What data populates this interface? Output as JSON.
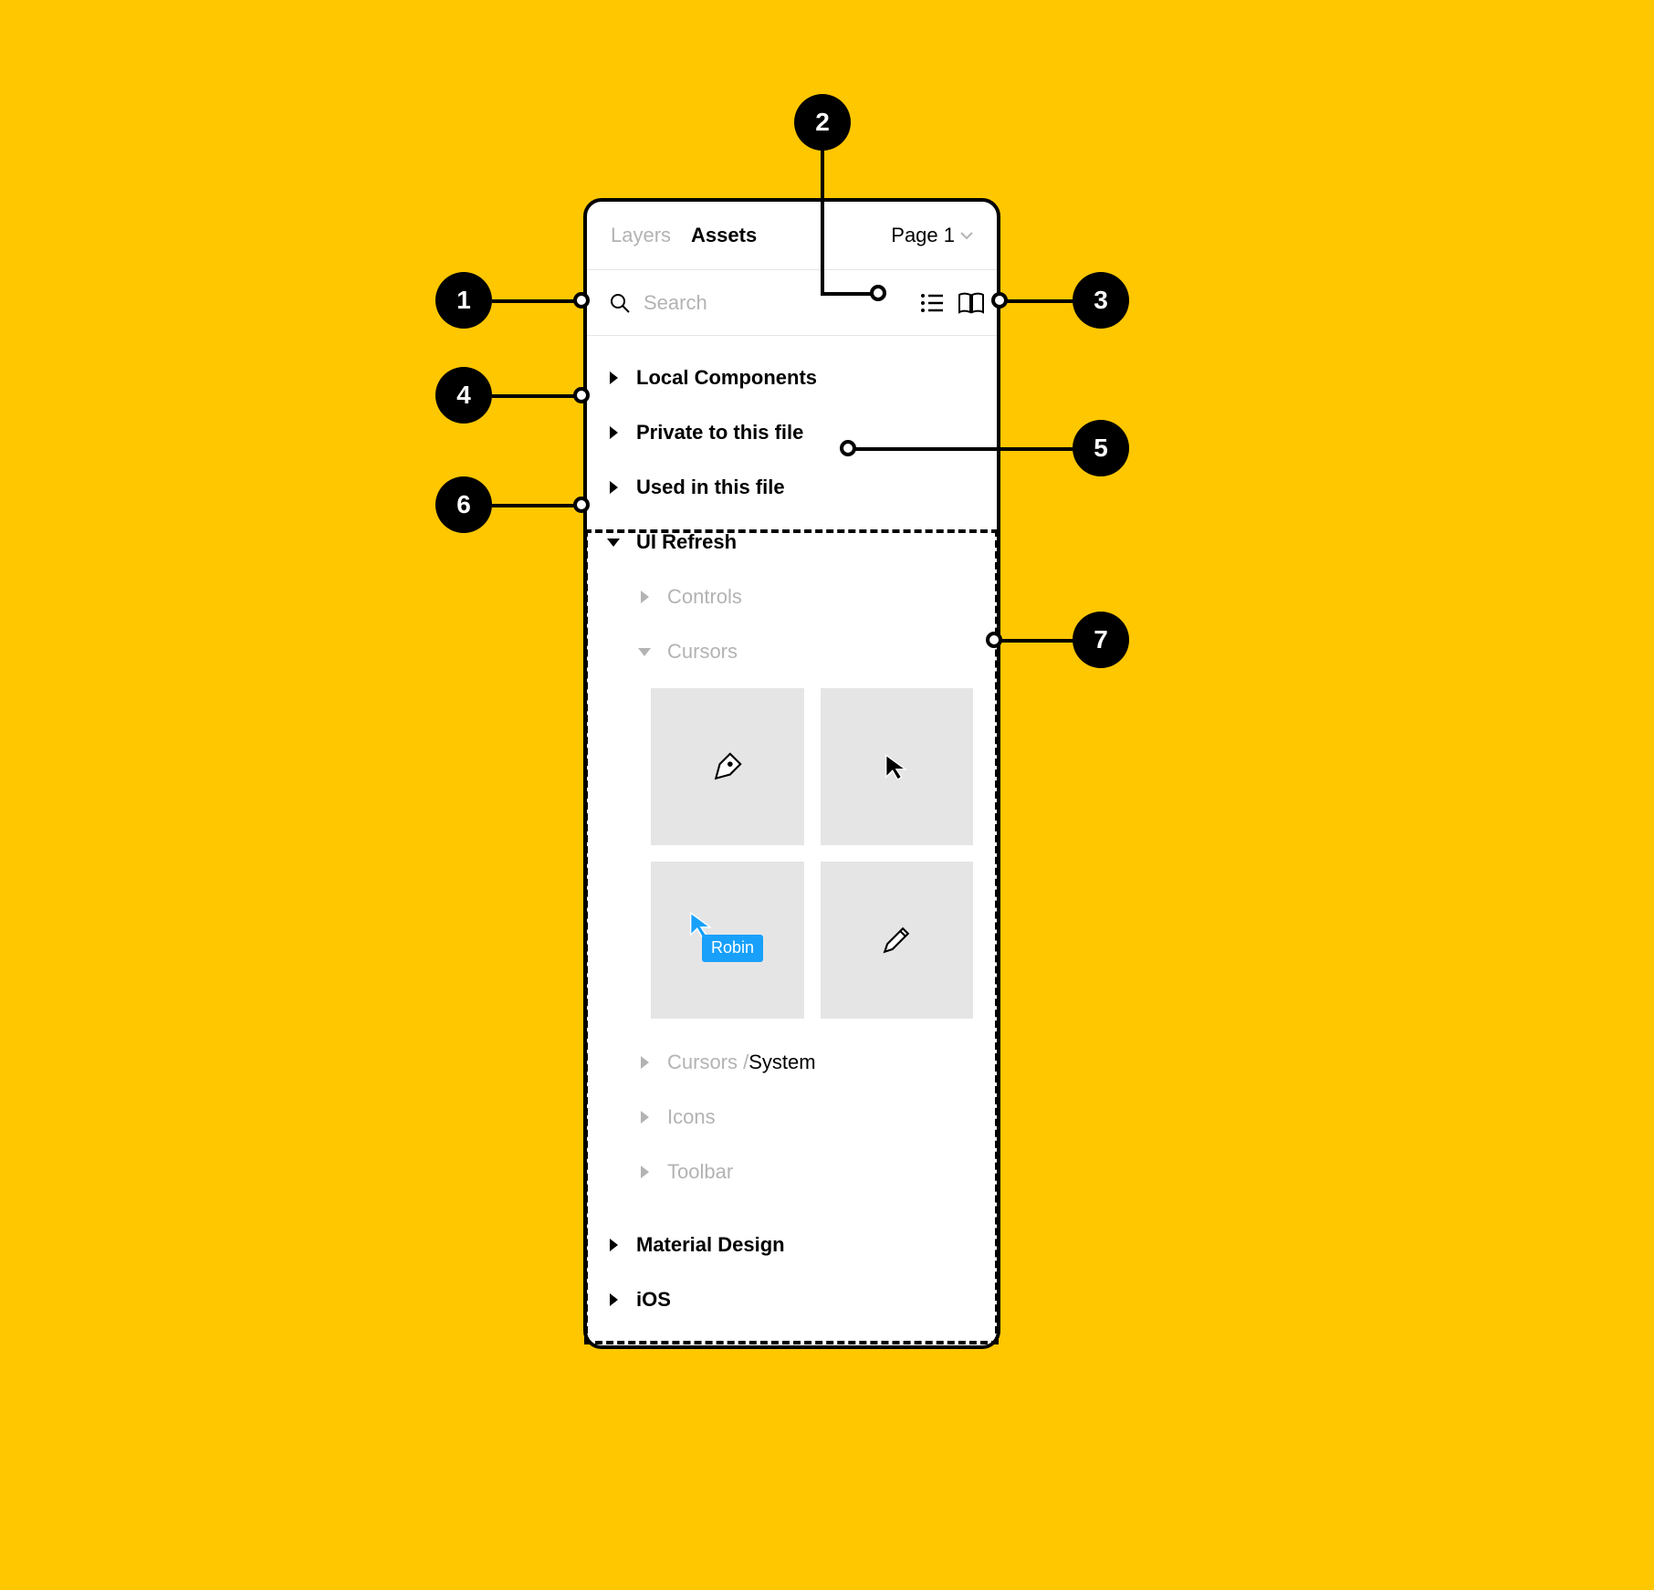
{
  "tabs": {
    "layers": "Layers",
    "assets": "Assets",
    "page": "Page 1"
  },
  "search": {
    "placeholder": "Search"
  },
  "sections": {
    "local_components": "Local Components",
    "private_to_file": "Private to this file",
    "used_in_file": "Used in this file",
    "ui_refresh": "UI Refresh",
    "controls": "Controls",
    "cursors": "Cursors",
    "cursors_system_prefix": "Cursors / ",
    "cursors_system_suffix": "System",
    "icons": "Icons",
    "toolbar": "Toolbar",
    "material_design": "Material Design",
    "ios": "iOS"
  },
  "thumbs": {
    "robin_label": "Robin"
  },
  "callouts": {
    "c1": "1",
    "c2": "2",
    "c3": "3",
    "c4": "4",
    "c5": "5",
    "c6": "6",
    "c7": "7"
  }
}
